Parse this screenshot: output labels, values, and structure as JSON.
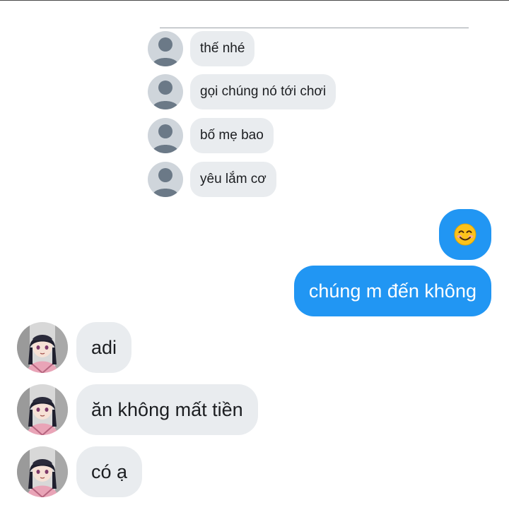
{
  "quoted_messages": [
    {
      "text": "thế nhé"
    },
    {
      "text": "gọi chúng nó tới chơi"
    },
    {
      "text": "bố mẹ bao"
    },
    {
      "text": "yêu lắm cơ"
    }
  ],
  "outgoing": {
    "emoji": "😊",
    "text": "chúng m đến không"
  },
  "incoming": [
    {
      "text": "adi"
    },
    {
      "text": "ăn không mất tiền"
    },
    {
      "text": "có ạ"
    }
  ],
  "colors": {
    "outgoing_bubble": "#2196f3",
    "incoming_bubble": "#e9ecef",
    "default_avatar": "#cfd5db"
  }
}
